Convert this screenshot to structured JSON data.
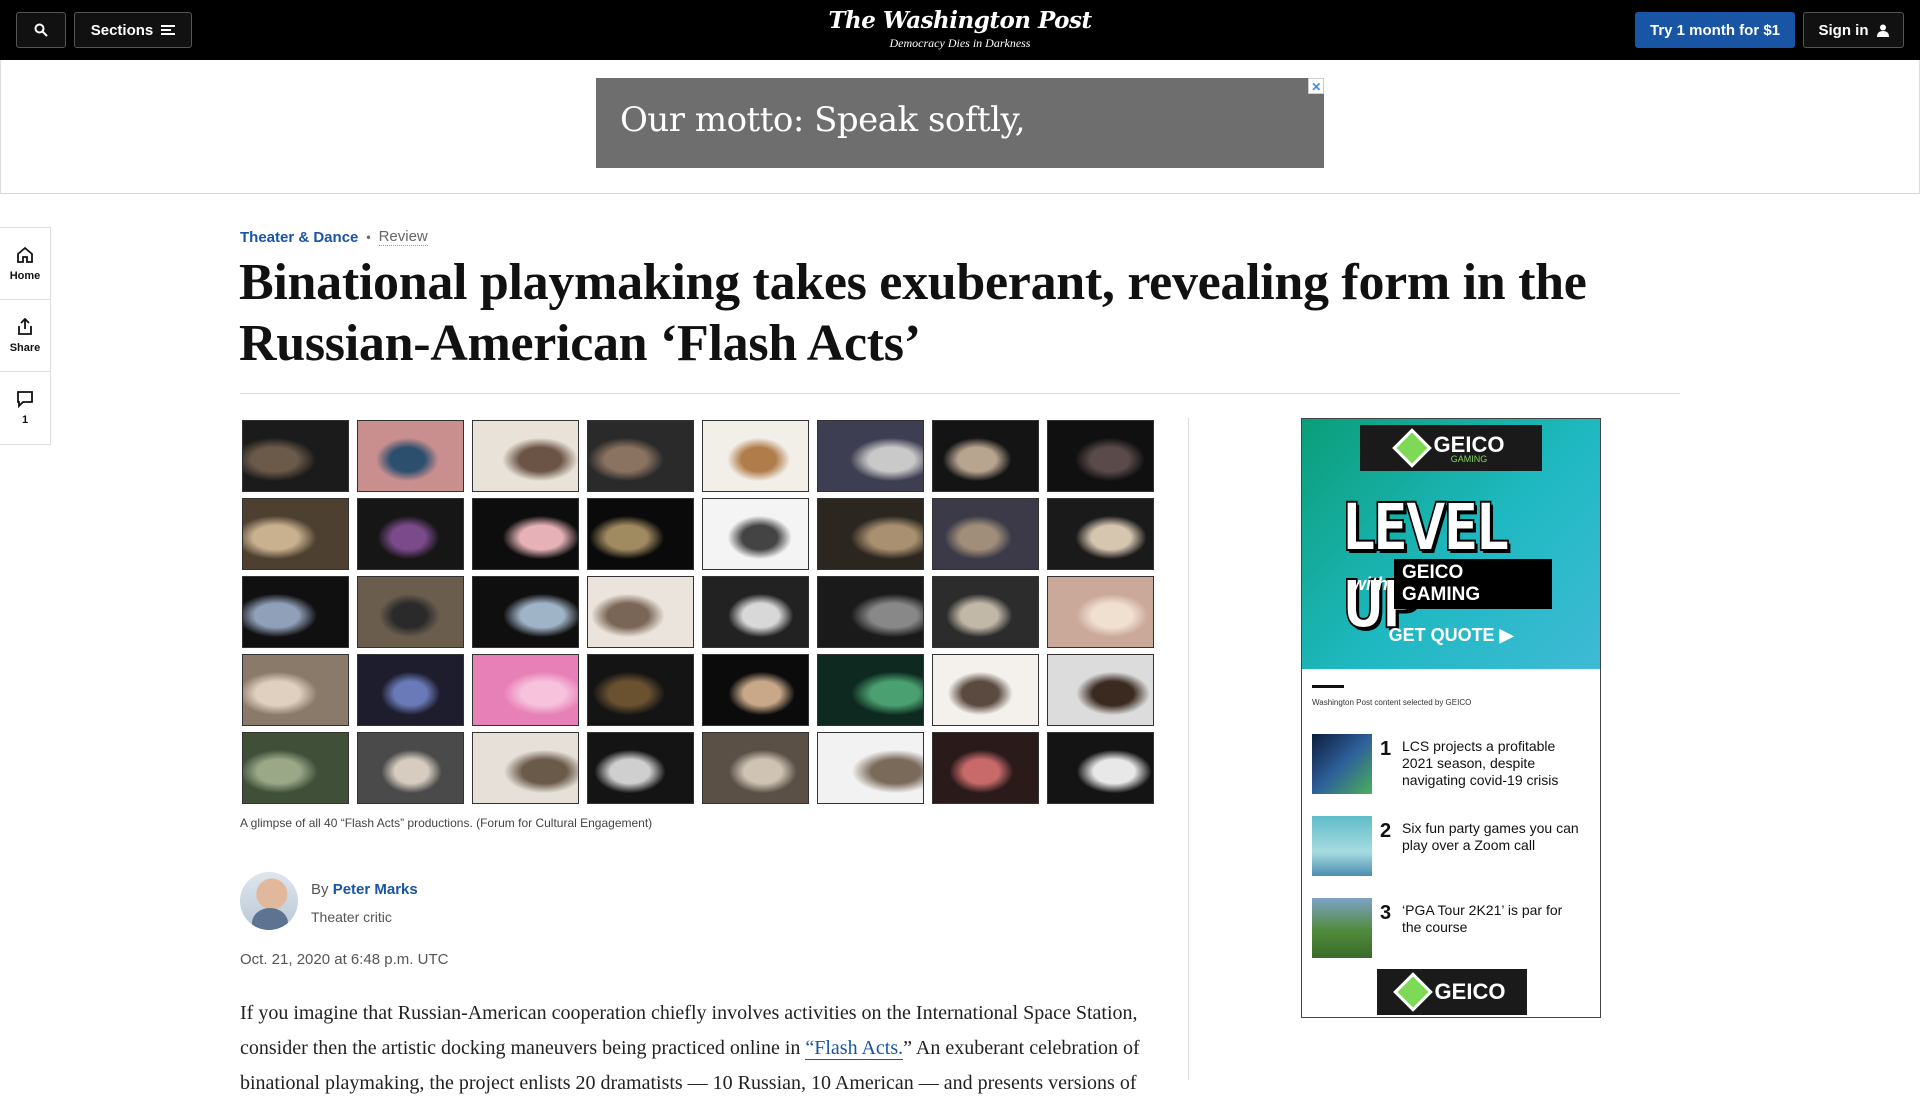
{
  "header": {
    "sections_label": "Sections",
    "logo_text": "The Washington Post",
    "tagline": "Democracy Dies in Darkness",
    "subscribe_label": "Try 1 month for $1",
    "signin_label": "Sign in"
  },
  "top_ad": {
    "text": "Our motto: Speak softly,",
    "close_glyph": "✕"
  },
  "rail": {
    "home_label": "Home",
    "share_label": "Share",
    "comments_count": "1"
  },
  "article": {
    "section": "Theater & Dance",
    "label": "Review",
    "headline": "Binational playmaking takes exuberant, revealing form in the Russian-American ‘Flash Acts’",
    "caption": "A glimpse of all 40 “Flash Acts” productions. (Forum for Cultural Engagement)",
    "by_prefix": "By",
    "author": "Peter Marks",
    "author_role": "Theater critic",
    "date": "Oct. 21, 2020 at 6:48 p.m. UTC",
    "body_part1": "If you imagine that Russian-American cooperation chiefly involves activities on the International Space Station, consider then the artistic docking maneuvers being practiced online in ",
    "body_link": "“Flash Acts.",
    "body_part2": "” An exuberant celebration of binational playmaking, the project enlists 20 dramatists — 10 Russian, 10 American — and presents versions of"
  },
  "side_ad": {
    "brand": "GEICO",
    "brand_sub": "GAMING",
    "headline": "LEVEL UP",
    "with_text": "with",
    "with_brand": "GEICO GAMING",
    "cta": "GET QUOTE ▶",
    "sponsor_note": "Washington Post content selected by GEICO",
    "items": [
      {
        "num": "1",
        "text": "LCS projects a profitable 2021 season, despite navigating covid-19 crisis"
      },
      {
        "num": "2",
        "text": "Six fun party games you can play over a Zoom call"
      },
      {
        "num": "3",
        "text": "‘PGA Tour 2K21’ is par for the course"
      }
    ]
  },
  "colors": {
    "accent": "#1955a5",
    "topbar": "#000000",
    "ad_gray": "#6e6e6e"
  }
}
